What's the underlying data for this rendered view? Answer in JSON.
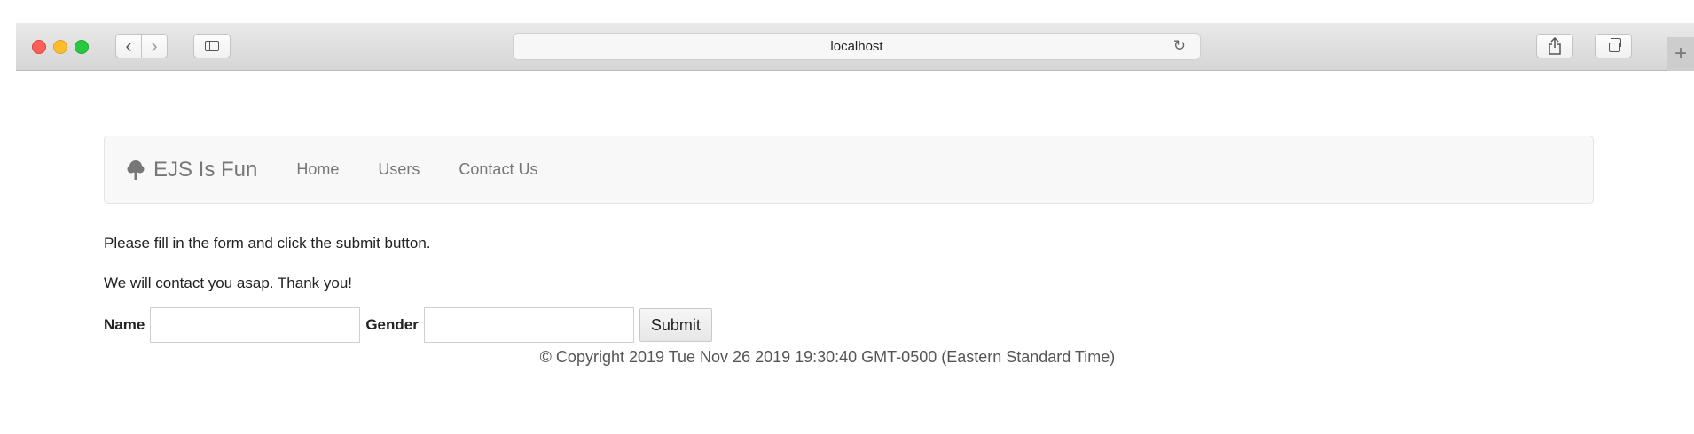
{
  "browser": {
    "url": "localhost",
    "back_icon": "‹",
    "forward_icon": "›",
    "reload_icon": "↻",
    "share_icon": "⇪",
    "new_tab_icon": "+"
  },
  "navbar": {
    "brand": "EJS Is Fun",
    "links": [
      "Home",
      "Users",
      "Contact Us"
    ]
  },
  "content": {
    "paragraph1": "Please fill in the form and click the submit button.",
    "paragraph2": "We will contact you asap. Thank you!"
  },
  "form": {
    "name_label": "Name",
    "name_value": "",
    "gender_label": "Gender",
    "gender_value": "",
    "submit_label": "Submit"
  },
  "footer": {
    "text": "© Copyright 2019 Tue Nov 26 2019 19:30:40 GMT-0500 (Eastern Standard Time)"
  }
}
